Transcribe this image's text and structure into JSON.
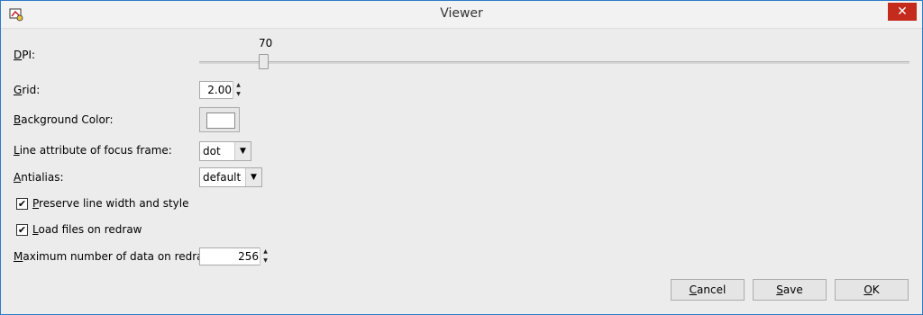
{
  "window": {
    "title": "Viewer",
    "close_glyph": "✕"
  },
  "dpi": {
    "label_ul": "D",
    "label_rest": "PI:",
    "value": "70"
  },
  "grid": {
    "label_ul": "G",
    "label_rest": "rid:",
    "value": "2.00"
  },
  "background_color": {
    "label_ul": "B",
    "label_rest": "ackground Color:",
    "color": "#ffffff"
  },
  "focus_frame": {
    "label_ul": "L",
    "label_rest": "ine attribute of focus frame:",
    "selected": "dot"
  },
  "antialias": {
    "label_ul": "A",
    "label_rest": "ntialias:",
    "selected": "default"
  },
  "preserve_line": {
    "label_ul": "P",
    "label_rest": "reserve line width and style",
    "checked": true
  },
  "load_files": {
    "label_ul": "L",
    "label_rest": "oad files on redraw",
    "checked": true
  },
  "max_data": {
    "label_ul": "M",
    "label_rest": "aximum number of data on redraw:",
    "value": "256"
  },
  "buttons": {
    "cancel_ul": "C",
    "cancel_rest": "ancel",
    "save_ul": "S",
    "save_rest": "ave",
    "ok_ul": "O",
    "ok_rest": "K"
  },
  "icons": {
    "app": "viewer-app-icon",
    "close": "close-icon",
    "spin_up": "▲",
    "spin_down": "▼",
    "dropdown": "▼",
    "check": "✔"
  }
}
